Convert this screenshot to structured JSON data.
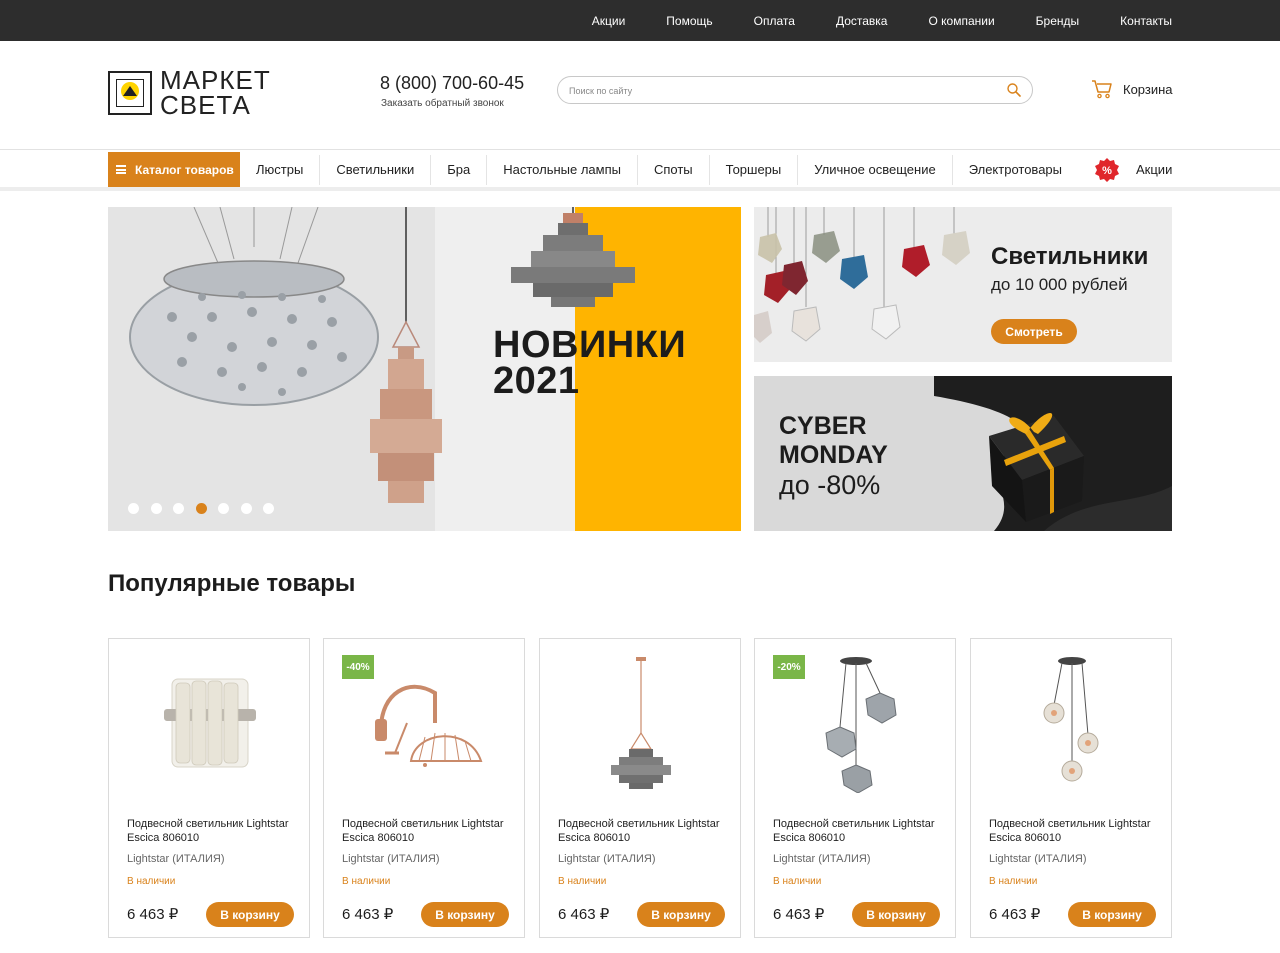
{
  "topnav": [
    "Акции",
    "Помощь",
    "Оплата",
    "Доставка",
    "О компании",
    "Бренды",
    "Контакты"
  ],
  "logo": {
    "line1": "МАРКЕТ",
    "line2": "СВЕТА"
  },
  "contact": {
    "phone": "8 (800) 700-60-45",
    "callback": "Заказать обратный звонок"
  },
  "search": {
    "placeholder": "Поиск по сайту",
    "value": ""
  },
  "cart": {
    "label": "Корзина"
  },
  "catalog_button": "Каталог товаров",
  "categories": [
    "Люстры",
    "Светильники",
    "Бра",
    "Настольные лампы",
    "Споты",
    "Торшеры",
    "Уличное освещение",
    "Электротовары"
  ],
  "promo_link": "Акции",
  "hero": {
    "title_line1": "НОВИНКИ",
    "title_line2": "2021",
    "slides_count": 7,
    "active_slide": 4
  },
  "banner1": {
    "title": "Светильники",
    "subtitle": "до 10 000 рублей",
    "button": "Смотреть"
  },
  "banner2": {
    "line1": "CYBER",
    "line2": "MONDAY",
    "subtitle": "до -80%"
  },
  "popular": {
    "title": "Популярные товары",
    "products": [
      {
        "discount": "",
        "name": "Подвесной светильник Lightstar Escica 806010",
        "brand": "Lightstar (ИТАЛИЯ)",
        "stock": "В наличии",
        "price": "6 463 ₽",
        "button": "В корзину"
      },
      {
        "discount": "-40%",
        "name": "Подвесной светильник Lightstar Escica 806010",
        "brand": "Lightstar (ИТАЛИЯ)",
        "stock": "В наличии",
        "price": "6 463 ₽",
        "button": "В корзину"
      },
      {
        "discount": "",
        "name": "Подвесной светильник Lightstar Escica 806010",
        "brand": "Lightstar (ИТАЛИЯ)",
        "stock": "В наличии",
        "price": "6 463 ₽",
        "button": "В корзину"
      },
      {
        "discount": "-20%",
        "name": "Подвесной светильник Lightstar Escica 806010",
        "brand": "Lightstar (ИТАЛИЯ)",
        "stock": "В наличии",
        "price": "6 463 ₽",
        "button": "В корзину"
      },
      {
        "discount": "",
        "name": "Подвесной светильник Lightstar Escica 806010",
        "brand": "Lightstar (ИТАЛИЯ)",
        "stock": "В наличии",
        "price": "6 463 ₽",
        "button": "В корзину"
      }
    ]
  },
  "colors": {
    "accent": "#d9821b",
    "topbar": "#2d2d2d",
    "hero_yellow": "#ffb400",
    "discount": "#7ab648"
  },
  "icons": {
    "search": "search-icon",
    "cart": "cart-icon",
    "menu": "menu-icon",
    "promo": "percent-badge-icon"
  }
}
